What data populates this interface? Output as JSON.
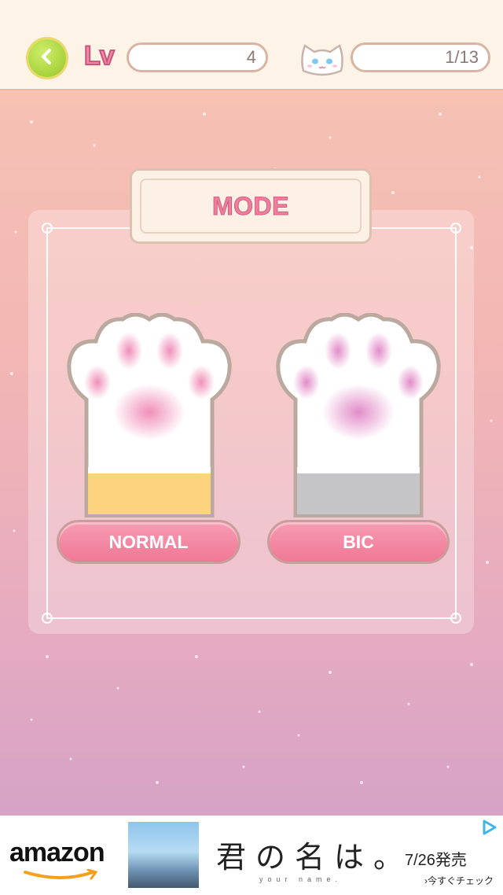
{
  "header": {
    "level_label": "Lv",
    "level_value": "4",
    "cats_value": "1/13"
  },
  "main": {
    "mode_title": "MODE",
    "modes": [
      {
        "label": "NORMAL",
        "sleeve_color": "#fcd37f"
      },
      {
        "label": "BIC",
        "sleeve_color": "#c5c5c7"
      }
    ]
  },
  "ad": {
    "brand": "amazon",
    "title": "君の名は。",
    "subtitle": "your name.",
    "date": "7/26発売",
    "cta": "›今すぐチェック"
  },
  "colors": {
    "accent_pink": "#ef7896",
    "back_green": "#a8d23b"
  },
  "icons": {
    "back": "back-arrow-icon",
    "cat": "cat-face-icon"
  }
}
